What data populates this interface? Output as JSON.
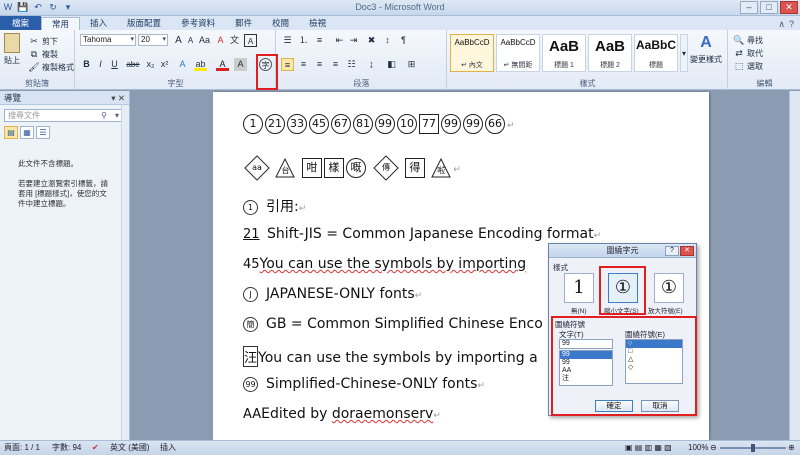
{
  "window": {
    "title": "Doc3 - Microsoft Word"
  },
  "qat": [
    "W",
    "💾",
    "↶",
    "↻",
    "▾"
  ],
  "tabs": {
    "file": "檔案",
    "items": [
      "常用",
      "插入",
      "版面配置",
      "參考資料",
      "郵件",
      "校閱",
      "檢視"
    ],
    "active": "常用"
  },
  "ribbon": {
    "clipboard": {
      "label": "剪貼簿",
      "paste": "貼上",
      "cut": "剪下",
      "copy": "複製",
      "format_painter": "複製格式"
    },
    "font": {
      "label": "字型",
      "name": "Tahoma",
      "size": "20",
      "bold": "B",
      "italic": "I",
      "underline": "U",
      "strike": "abe",
      "sub": "x₂",
      "sup": "x²",
      "grow": "A",
      "shrink": "A",
      "case": "Aa",
      "clear": "A"
    },
    "paragraph": {
      "label": "段落"
    },
    "styles": {
      "label": "樣式",
      "items": [
        {
          "sample": "AaBbCcD",
          "name": "↵ 內文"
        },
        {
          "sample": "AaBbCcD",
          "name": "↵ 無間距"
        },
        {
          "sample": "AaB",
          "name": "標題 1"
        },
        {
          "sample": "AaB",
          "name": "標題 2"
        },
        {
          "sample": "AaBbC",
          "name": "標題"
        }
      ],
      "change": "變更樣式"
    },
    "editing": {
      "label": "編輯",
      "find": "尋找",
      "replace": "取代",
      "select": "選取"
    }
  },
  "nav": {
    "title": "導覽",
    "search_placeholder": "搜尋文件",
    "message1": "此文件不含標題。",
    "message2_l1": "若要建立瀏覽索引標籤，請",
    "message2_l2": "套用 [標題樣式]，使您的文",
    "message2_l3": "件中建立標題。"
  },
  "doc": {
    "line1": [
      "1",
      "21",
      "33",
      "45",
      "67",
      "81",
      "99",
      "10",
      "77",
      "99",
      "99",
      "66"
    ],
    "line2_text": [
      "咁",
      "樣",
      "嘅",
      "傳",
      "得"
    ],
    "line2_first": "aa",
    "line3_circ": "1",
    "line3_text": "引用:",
    "line4_prefix": "21",
    "line4_text": "Shift-JIS = Common Japanese Encoding format",
    "line5_prefix": "45",
    "line5_text": "You can use the symbols by importing",
    "line6_circ": "J",
    "line6_text": "JAPANESE-ONLY fonts",
    "line7_circ": "簡",
    "line7_text": "GB = Common Simplified Chinese Enco",
    "line8_prefix": "汪",
    "line8_text": "You can use the symbols by importing a",
    "line9_circ": "99",
    "line9_text": "Simplified-Chinese-ONLY fonts",
    "line10_prefix": "AA",
    "line10_text": "Edited by ",
    "line10_name": "doraemonserv"
  },
  "dialog": {
    "title": "圍繞字元",
    "style_label": "樣式",
    "styles": [
      {
        "glyph": "1",
        "caption": "無(N)"
      },
      {
        "glyph": "①",
        "caption": "縮小文字(S)"
      },
      {
        "glyph": "①",
        "caption": "放大符號(E)"
      }
    ],
    "enclose_label": "圍繞符號",
    "text_label": "文字(T)",
    "text_value": "99",
    "text_items": [
      "99",
      "99",
      "AA",
      "注",
      "—"
    ],
    "symbol_label": "圍繞符號(E)",
    "symbol_items": [
      "○",
      "□",
      "△",
      "◇"
    ],
    "ok": "確定",
    "cancel": "取消"
  },
  "status": {
    "page": "頁面: 1 / 1",
    "words": "字數: 94",
    "lang": "英文 (美國)",
    "mode": "插入",
    "zoom": "100%"
  }
}
